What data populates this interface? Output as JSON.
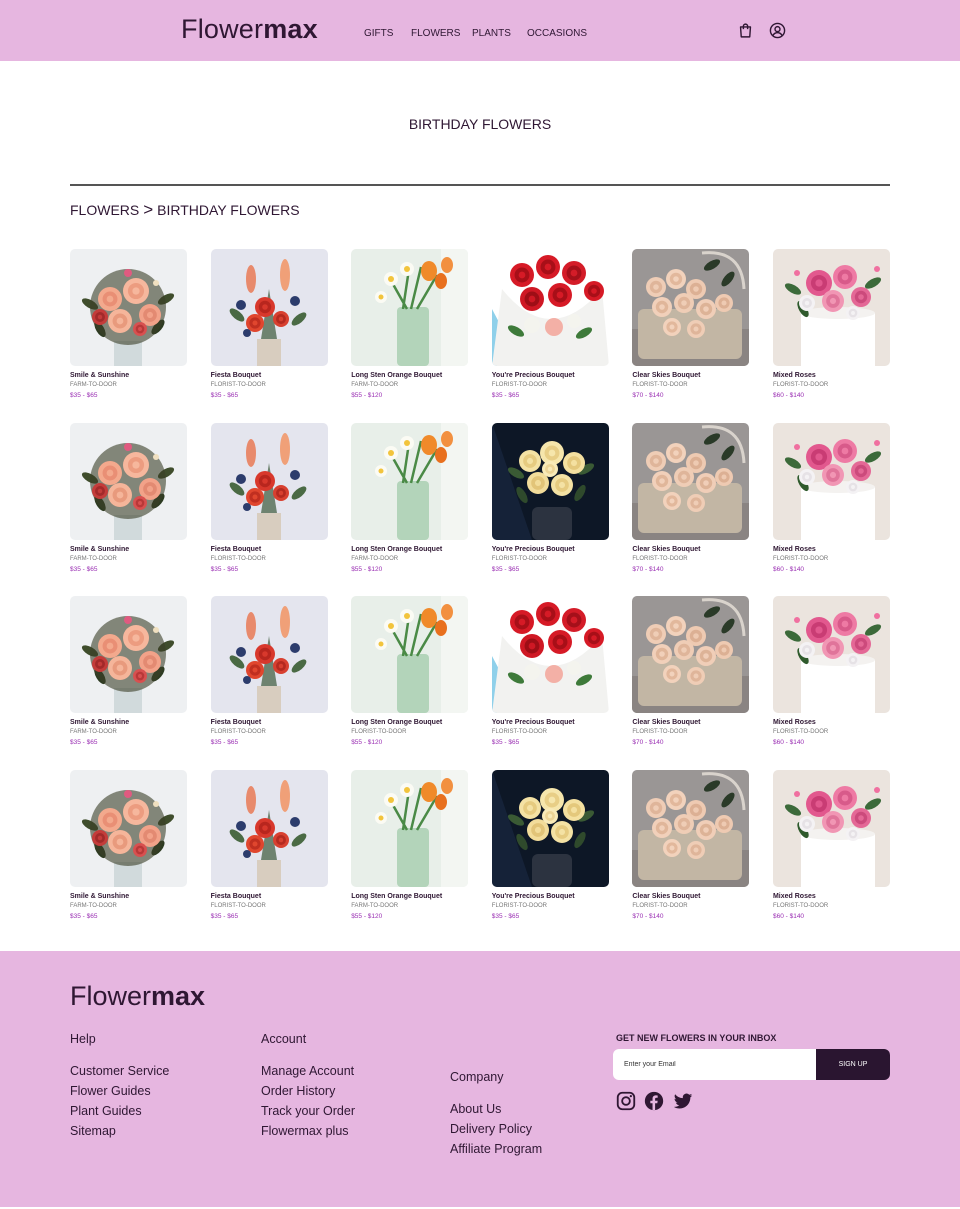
{
  "header": {
    "logo_light": "Flower",
    "logo_bold": "max",
    "nav": [
      "GIFTS",
      "FLOWERS",
      "PLANTS",
      "OCCASIONS"
    ]
  },
  "page": {
    "title": "BIRTHDAY FLOWERS",
    "breadcrumb": [
      "FLOWERS",
      ">",
      "BIRTHDAY FLOWERS"
    ]
  },
  "products": [
    {
      "name": "Smile & Sunshine",
      "source": "FARM-TO-DOOR",
      "price": "$35 - $65",
      "image": "peach-rose-bouquet"
    },
    {
      "name": "Fiesta Bouquet",
      "source": "FLORIST-TO-DOOR",
      "price": "$35 - $65",
      "image": "red-snapdragon-bouquet"
    },
    {
      "name": "Long Sten Orange Bouquet",
      "source": "FARM-TO-DOOR",
      "price": "$55 - $120",
      "image": "orange-tulip-daffodil-vase"
    },
    {
      "name": "You're Precious Bouquet",
      "source": "FLORIST-TO-DOOR",
      "price": "$35 - $65",
      "image": "red-rose-wrapped-bouquet"
    },
    {
      "name": "Clear Skies Bouquet",
      "source": "FLORIST-TO-DOOR",
      "price": "$70 - $140",
      "image": "peach-rose-basket"
    },
    {
      "name": "Mixed Roses",
      "source": "FLORIST-TO-DOOR",
      "price": "$60 - $140",
      "image": "pink-rose-box"
    },
    {
      "name": "Smile & Sunshine",
      "source": "FARM-TO-DOOR",
      "price": "$35 - $65",
      "image": "peach-rose-bouquet"
    },
    {
      "name": "Fiesta Bouquet",
      "source": "FLORIST-TO-DOOR",
      "price": "$35 - $65",
      "image": "red-snapdragon-bouquet"
    },
    {
      "name": "Long Sten Orange Bouquet",
      "source": "FARM-TO-DOOR",
      "price": "$55 - $120",
      "image": "orange-tulip-daffodil-vase"
    },
    {
      "name": "You're Precious Bouquet",
      "source": "FLORIST-TO-DOOR",
      "price": "$35 - $65",
      "image": "yellow-rose-dark-vase"
    },
    {
      "name": "Clear Skies Bouquet",
      "source": "FLORIST-TO-DOOR",
      "price": "$70 - $140",
      "image": "peach-rose-basket"
    },
    {
      "name": "Mixed Roses",
      "source": "FLORIST-TO-DOOR",
      "price": "$60 - $140",
      "image": "pink-rose-box"
    },
    {
      "name": "Smile & Sunshine",
      "source": "FARM-TO-DOOR",
      "price": "$35 - $65",
      "image": "peach-rose-bouquet"
    },
    {
      "name": "Fiesta Bouquet",
      "source": "FLORIST-TO-DOOR",
      "price": "$35 - $65",
      "image": "red-snapdragon-bouquet"
    },
    {
      "name": "Long Sten Orange Bouquet",
      "source": "FLORIST-TO-DOOR",
      "price": "$55 - $120",
      "image": "orange-tulip-daffodil-vase"
    },
    {
      "name": "You're Precious Bouquet",
      "source": "FLORIST-TO-DOOR",
      "price": "$35 - $65",
      "image": "red-rose-wrapped-bouquet"
    },
    {
      "name": "Clear Skies Bouquet",
      "source": "FLORIST-TO-DOOR",
      "price": "$70 - $140",
      "image": "peach-rose-basket"
    },
    {
      "name": "Mixed Roses",
      "source": "FLORIST-TO-DOOR",
      "price": "$60 - $140",
      "image": "pink-rose-box"
    },
    {
      "name": "Smile & Sunshine",
      "source": "FARM-TO-DOOR",
      "price": "$35 - $65",
      "image": "peach-rose-bouquet"
    },
    {
      "name": "Fiesta Bouquet",
      "source": "FLORIST-TO-DOOR",
      "price": "$35 - $65",
      "image": "red-snapdragon-bouquet"
    },
    {
      "name": "Long Sten Orange Bouquet",
      "source": "FARM-TO-DOOR",
      "price": "$55 - $120",
      "image": "orange-tulip-daffodil-vase"
    },
    {
      "name": "You're Precious Bouquet",
      "source": "FLORIST-TO-DOOR",
      "price": "$35 - $65",
      "image": "yellow-rose-dark-vase"
    },
    {
      "name": "Clear Skies Bouquet",
      "source": "FLORIST-TO-DOOR",
      "price": "$70 - $140",
      "image": "peach-rose-basket"
    },
    {
      "name": "Mixed Roses",
      "source": "FLORIST-TO-DOOR",
      "price": "$60 - $140",
      "image": "pink-rose-box"
    }
  ],
  "footer": {
    "logo_light": "Flower",
    "logo_bold": "max",
    "help": {
      "title": "Help",
      "links": [
        "Customer Service",
        "Flower Guides",
        "Plant Guides",
        "Sitemap"
      ]
    },
    "account": {
      "title": "Account",
      "links": [
        "Manage Account",
        "Order History",
        "Track your Order",
        "Flowermax plus"
      ]
    },
    "company": {
      "title": "Company",
      "links": [
        "About Us",
        "Delivery Policy",
        "Affiliate Program"
      ]
    },
    "newsletter": {
      "title": "GET NEW FLOWERS IN YOUR INBOX",
      "placeholder": "Enter your Email",
      "button": "SIGN UP"
    },
    "social": [
      "instagram-icon",
      "facebook-icon",
      "twitter-icon"
    ]
  },
  "colors": {
    "brand_pink": "#e6b6e0",
    "brand_dark": "#2f1733",
    "price_purple": "#9a2fb3"
  }
}
